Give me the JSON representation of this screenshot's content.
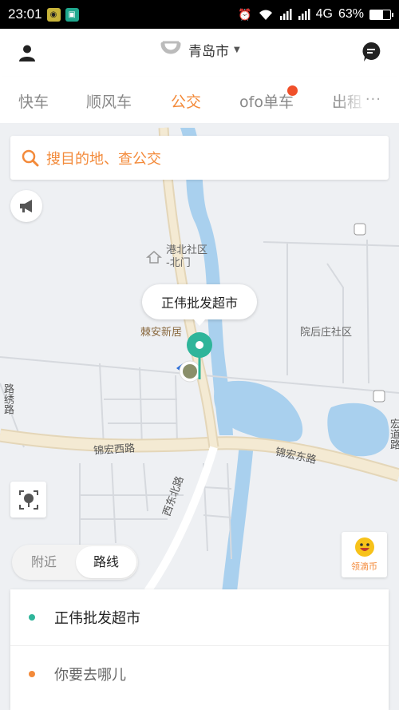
{
  "status_bar": {
    "time": "23:01",
    "network": "4G",
    "battery": "63%",
    "battery_level": 0.63
  },
  "header": {
    "city": "青岛市",
    "left_icon": "user-icon",
    "right_icon": "message-icon"
  },
  "tabs": {
    "items": [
      "快车",
      "顺风车",
      "公交",
      "ofo单车",
      "出租"
    ],
    "active": "公交",
    "more_label": "···"
  },
  "search": {
    "placeholder": "搜目的地、查公交"
  },
  "map": {
    "labels": {
      "community_north_gate": "港北社区\n-北门",
      "new_residence": "棘安新居",
      "village": "院后庄社区",
      "store_bubble": "正伟批发超市"
    },
    "roads": {
      "jinhong_west": "锦宏西路",
      "jinhong_east": "锦宏东路",
      "xidong_north": "西东北路",
      "left_road": "路绣路",
      "right_road": "宏道路"
    }
  },
  "coin_button": {
    "label": "领滴币"
  },
  "mode_toggle": {
    "nearby": "附近",
    "route": "路线",
    "selected": "路线"
  },
  "route_panel": {
    "origin": "正伟批发超市",
    "destination_placeholder": "你要去哪儿"
  },
  "colors": {
    "accent": "#f38a3a",
    "origin_green": "#2fb59a",
    "water": "#a9d0ee",
    "road": "#f3ead5"
  }
}
